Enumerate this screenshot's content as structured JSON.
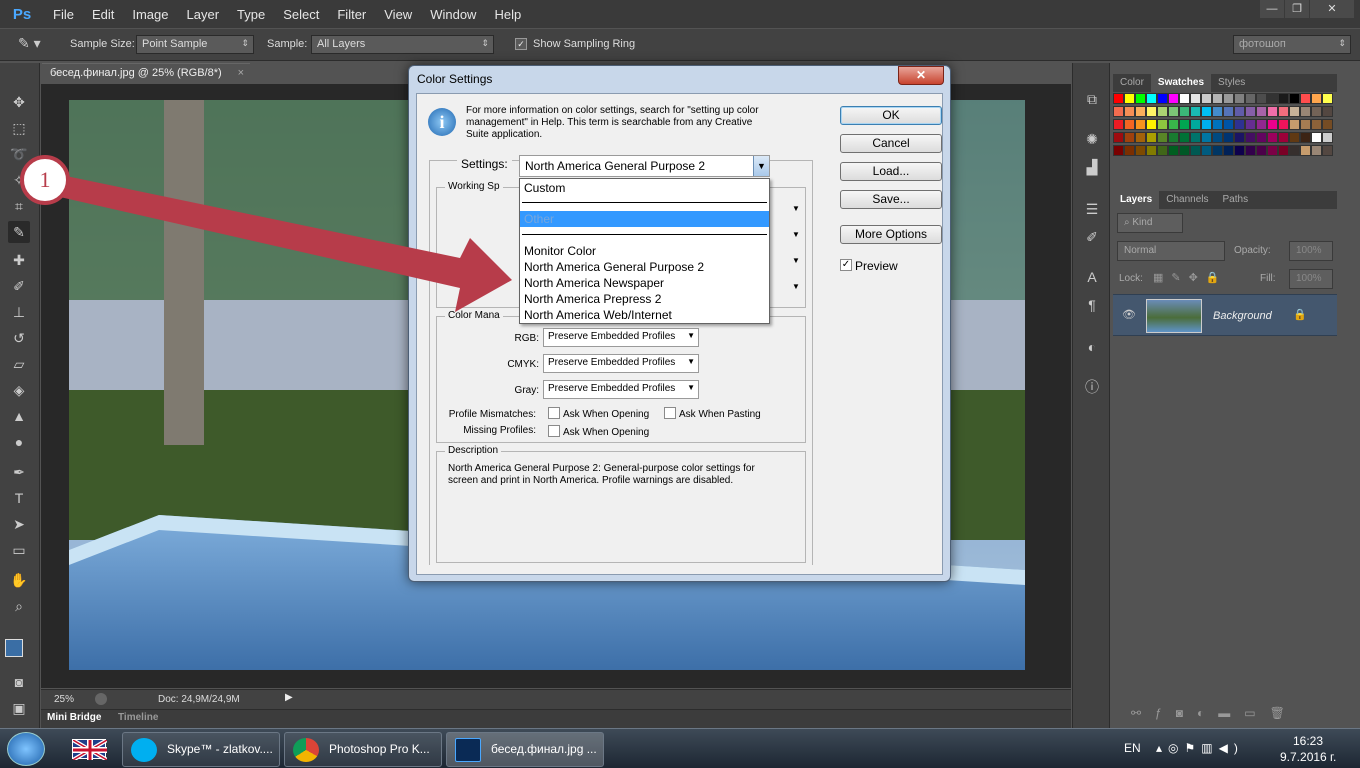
{
  "app": {
    "logo": "Ps"
  },
  "menu": [
    "File",
    "Edit",
    "Image",
    "Layer",
    "Type",
    "Select",
    "Filter",
    "View",
    "Window",
    "Help"
  ],
  "window_controls": {
    "minimize": "—",
    "restore": "❐",
    "close": "✕"
  },
  "options": {
    "sample_size_label": "Sample Size:",
    "sample_size_value": "Point Sample",
    "sample_label": "Sample:",
    "sample_value": "All Layers",
    "show_ring_label": "Show Sampling Ring",
    "workspace_value": "фотошоп"
  },
  "document": {
    "tab_title": "бесед.финал.jpg @ 25% (RGB/8*)",
    "tab_close": "×"
  },
  "status": {
    "zoom": "25%",
    "doc_info": "Doc: 24,9M/24,9M"
  },
  "bottom_tabs": {
    "mini_bridge": "Mini Bridge",
    "timeline": "Timeline"
  },
  "swatch_tabs": [
    "Color",
    "Swatches",
    "Styles"
  ],
  "layer_tabs": [
    "Layers",
    "Channels",
    "Paths"
  ],
  "layers": {
    "kind": "Kind",
    "blend": "Normal",
    "opacity_label": "Opacity:",
    "opacity_value": "100%",
    "lock_label": "Lock:",
    "fill_label": "Fill:",
    "fill_value": "100%",
    "layer_name": "Background"
  },
  "dialog": {
    "title": "Color Settings",
    "close": "✕",
    "info_text": "For more information on color settings, search for \"setting up color management\" in Help. This term is searchable from any Creative Suite application.",
    "settings_label": "Settings:",
    "settings_value": "North America General Purpose 2",
    "working_spaces_label": "Working Sp",
    "color_management_label": "Color Mana",
    "rgb_label": "RGB:",
    "rgb_value": "Preserve Embedded Profiles",
    "cmyk_label": "CMYK:",
    "cmyk_value": "Preserve Embedded Profiles",
    "gray_label": "Gray:",
    "gray_value": "Preserve Embedded Profiles",
    "profile_mismatches_label": "Profile Mismatches:",
    "ask_opening_label": "Ask When Opening",
    "ask_pasting_label": "Ask When Pasting",
    "missing_profiles_label": "Missing Profiles:",
    "ask_opening_label_2": "Ask When Opening",
    "description_label": "Description",
    "description_text": "North America General Purpose 2:  General-purpose color settings for screen and print in North America. Profile warnings are disabled.",
    "buttons": {
      "ok": "OK",
      "cancel": "Cancel",
      "load": "Load...",
      "save": "Save...",
      "more_options": "More Options"
    },
    "preview_label": "Preview",
    "dropdown": {
      "custom": "Custom",
      "other": "Other",
      "monitor": "Monitor Color",
      "na_general": "North America General Purpose 2",
      "na_newspaper": "North America Newspaper",
      "na_prepress": "North America Prepress 2",
      "na_web": "North America Web/Internet"
    }
  },
  "callout": {
    "number": "1",
    "color": "#b73c4a"
  },
  "taskbar": {
    "skype": "Skype™ - zlatkov....",
    "chrome": "Photoshop Pro K...",
    "photoshop": "бесед.финал.jpg ...",
    "lang": "EN",
    "time": "16:23",
    "date": "9.7.2016 г."
  }
}
